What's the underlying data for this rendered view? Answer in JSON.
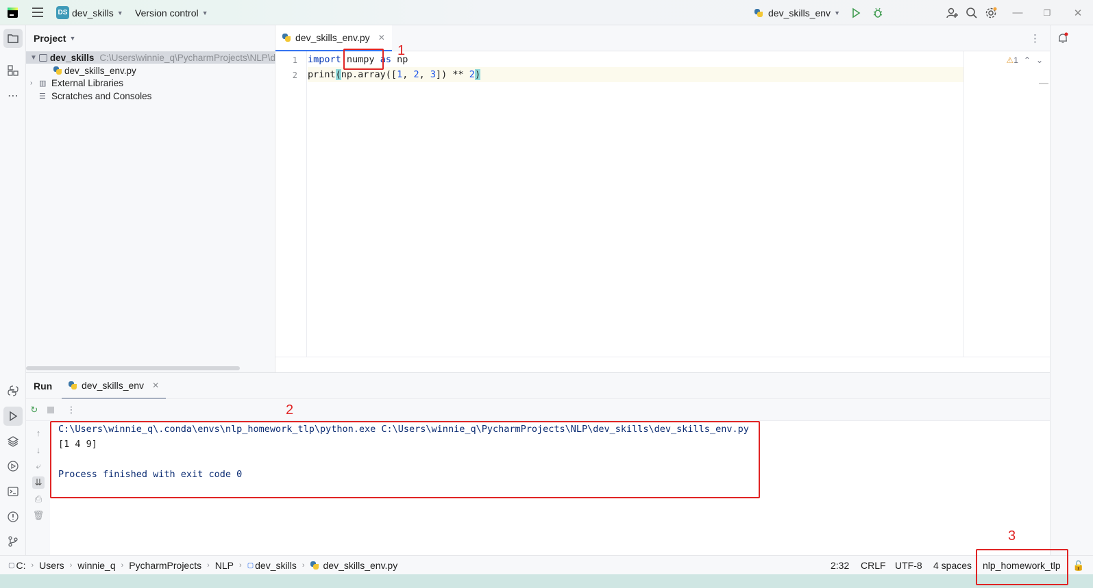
{
  "titlebar": {
    "project_badge": "DS",
    "project_name": "dev_skills",
    "version_control": "Version control",
    "run_config": "dev_skills_env"
  },
  "project_panel": {
    "title": "Project",
    "root_name": "dev_skills",
    "root_path": "C:\\Users\\winnie_q\\PycharmProjects\\NLP\\d",
    "file": "dev_skills_env.py",
    "external": "External Libraries",
    "scratches": "Scratches and Consoles"
  },
  "editor": {
    "tab_label": "dev_skills_env.py",
    "line_numbers": [
      "1",
      "2"
    ],
    "line1": {
      "kw1": "import",
      "mod": " numpy ",
      "kw2": "as",
      "alias": " np"
    },
    "line2": {
      "fn": "print",
      "open": "(",
      "mid1": "np.array([",
      "n1": "1",
      "c1": ", ",
      "n2": "2",
      "c2": ", ",
      "n3": "3",
      "mid2": "]) ** ",
      "n4": "2",
      "close": ")"
    },
    "warning_count": "1"
  },
  "run_panel": {
    "title": "Run",
    "tab_label": "dev_skills_env",
    "console": [
      "C:\\Users\\winnie_q\\.conda\\envs\\nlp_homework_tlp\\python.exe C:\\Users\\winnie_q\\PycharmProjects\\NLP\\dev_skills\\dev_skills_env.py",
      "[1 4 9]",
      "",
      "Process finished with exit code 0"
    ]
  },
  "statusbar": {
    "breadcrumbs": [
      "C:",
      "Users",
      "winnie_q",
      "PycharmProjects",
      "NLP",
      "dev_skills",
      "dev_skills_env.py"
    ],
    "position": "2:32",
    "line_ending": "CRLF",
    "encoding": "UTF-8",
    "indent": "4 spaces",
    "interpreter": "nlp_homework_tlp"
  },
  "annotations": [
    "1",
    "2",
    "3"
  ],
  "colors": {
    "annotation": "#e02424",
    "accent": "#3574f0",
    "keyword": "#0033b3",
    "number": "#1750eb",
    "console_text": "#0a2b72"
  }
}
